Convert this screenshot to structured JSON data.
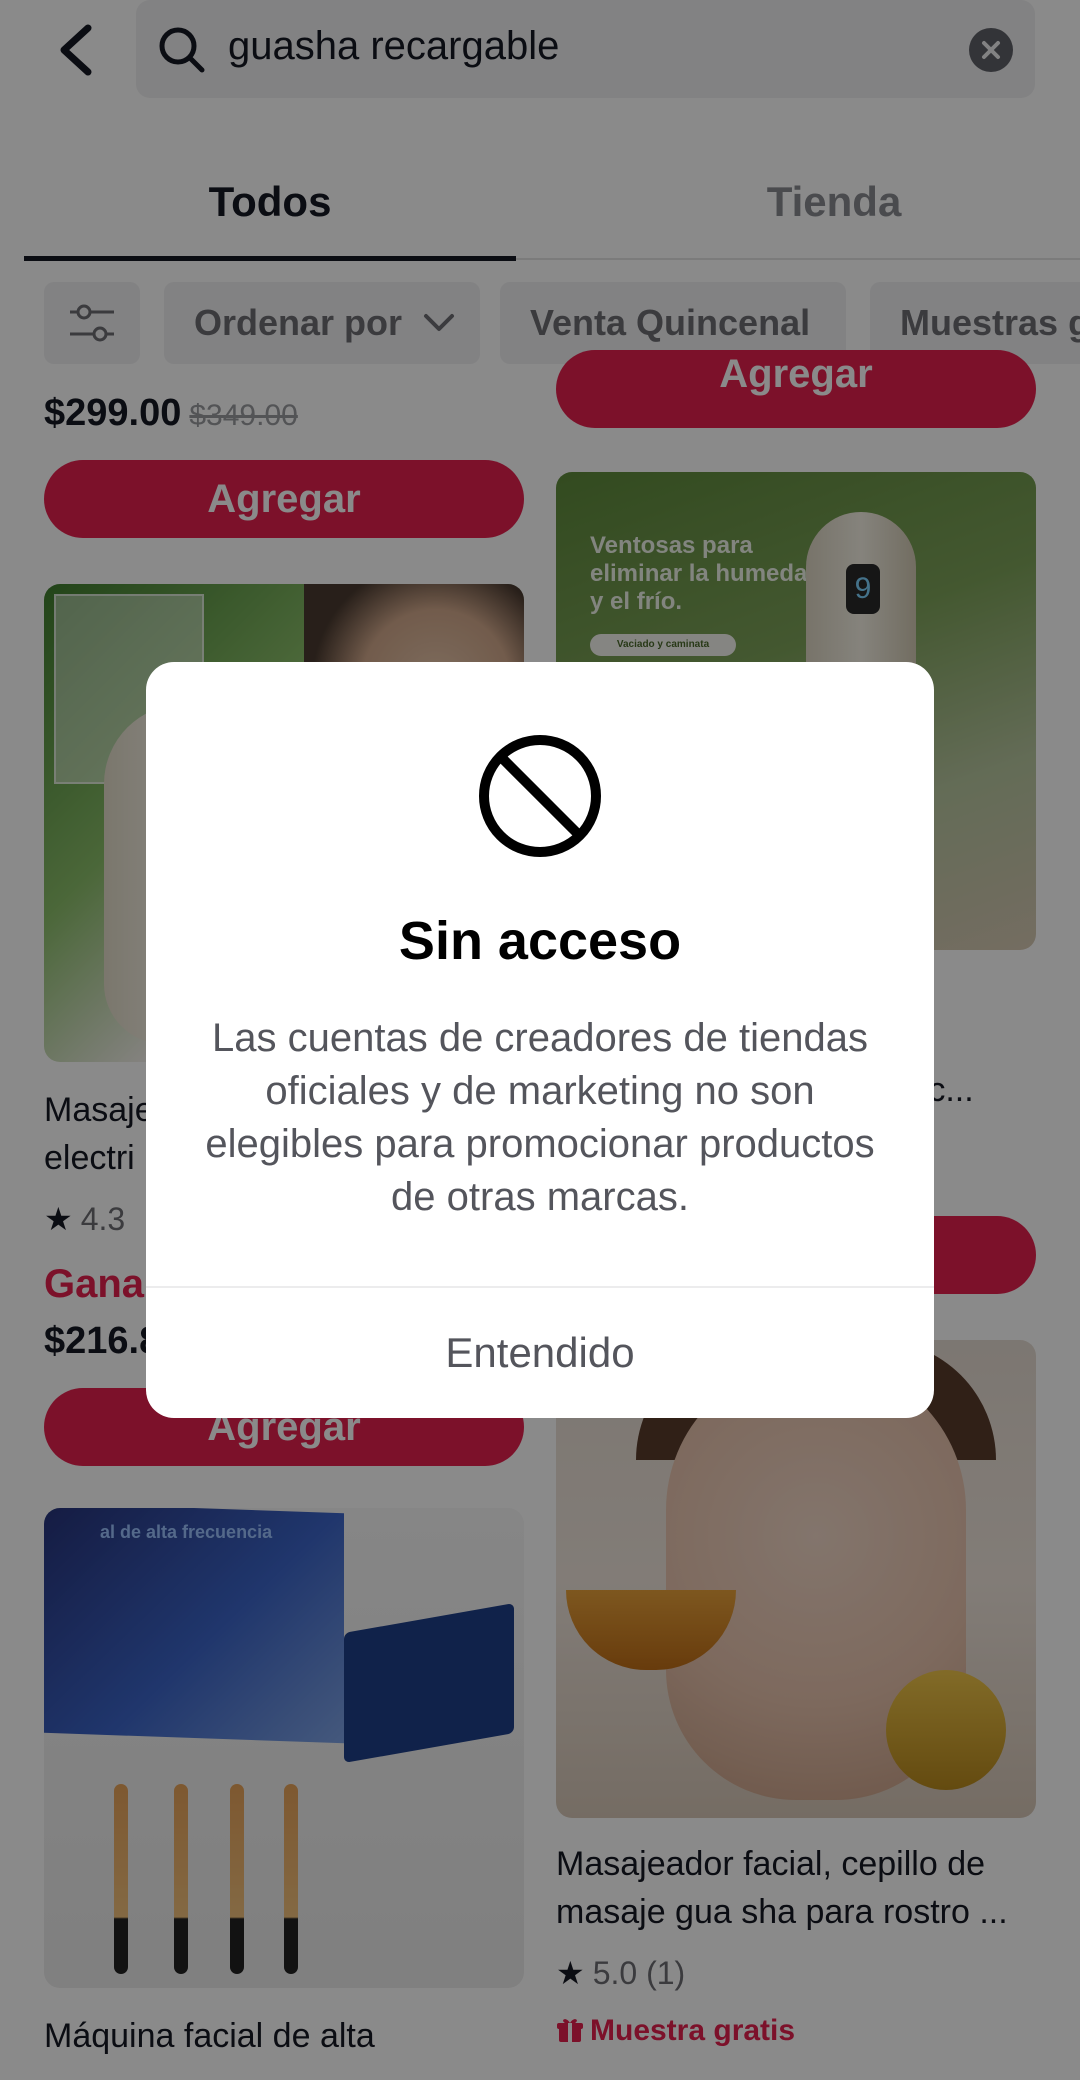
{
  "search": {
    "query": "guasha recargable"
  },
  "tabs": [
    {
      "label": "Todos",
      "active": true
    },
    {
      "label": "Tienda",
      "active": false
    }
  ],
  "filters": {
    "sort_label": "Ordenar por",
    "chips": [
      "Venta Quincenal",
      "Muestras g"
    ]
  },
  "products": {
    "left_top": {
      "price": "$299.00",
      "old_price": "$349.00",
      "button": "Agregar"
    },
    "right_top": {
      "button": "Agregar"
    },
    "left_mid": {
      "title_fragment": "Masaje\nelectri",
      "rating": "4.3",
      "promo": "Gana",
      "price": "$216.8",
      "button": "Agregar",
      "image_text_pill": "",
      "image_box_title": ""
    },
    "right_mid": {
      "image_text": "Ventosas para eliminar la humedad y el frío.",
      "image_pill": "Vaciado y caminata",
      "screen_digit": "9",
      "title_fragment": "o\ntric..."
    },
    "left_bottom": {
      "image_title": "al de alta frecuencia",
      "title": "Máquina facial de alta"
    },
    "right_bottom": {
      "title": "Masajeador facial, cepillo de masaje gua sha para rostro ...",
      "rating": "5.0",
      "rating_count": "(1)",
      "sample": "Muestra gratis"
    }
  },
  "dialog": {
    "title": "Sin acceso",
    "body": "Las cuentas de creadores de tiendas oficiales y de marketing no son elegibles para promocionar productos de otras marcas.",
    "confirm": "Entendido"
  },
  "colors": {
    "accent": "#e5204e",
    "overlay": "rgba(0,0,0,0.46)"
  }
}
